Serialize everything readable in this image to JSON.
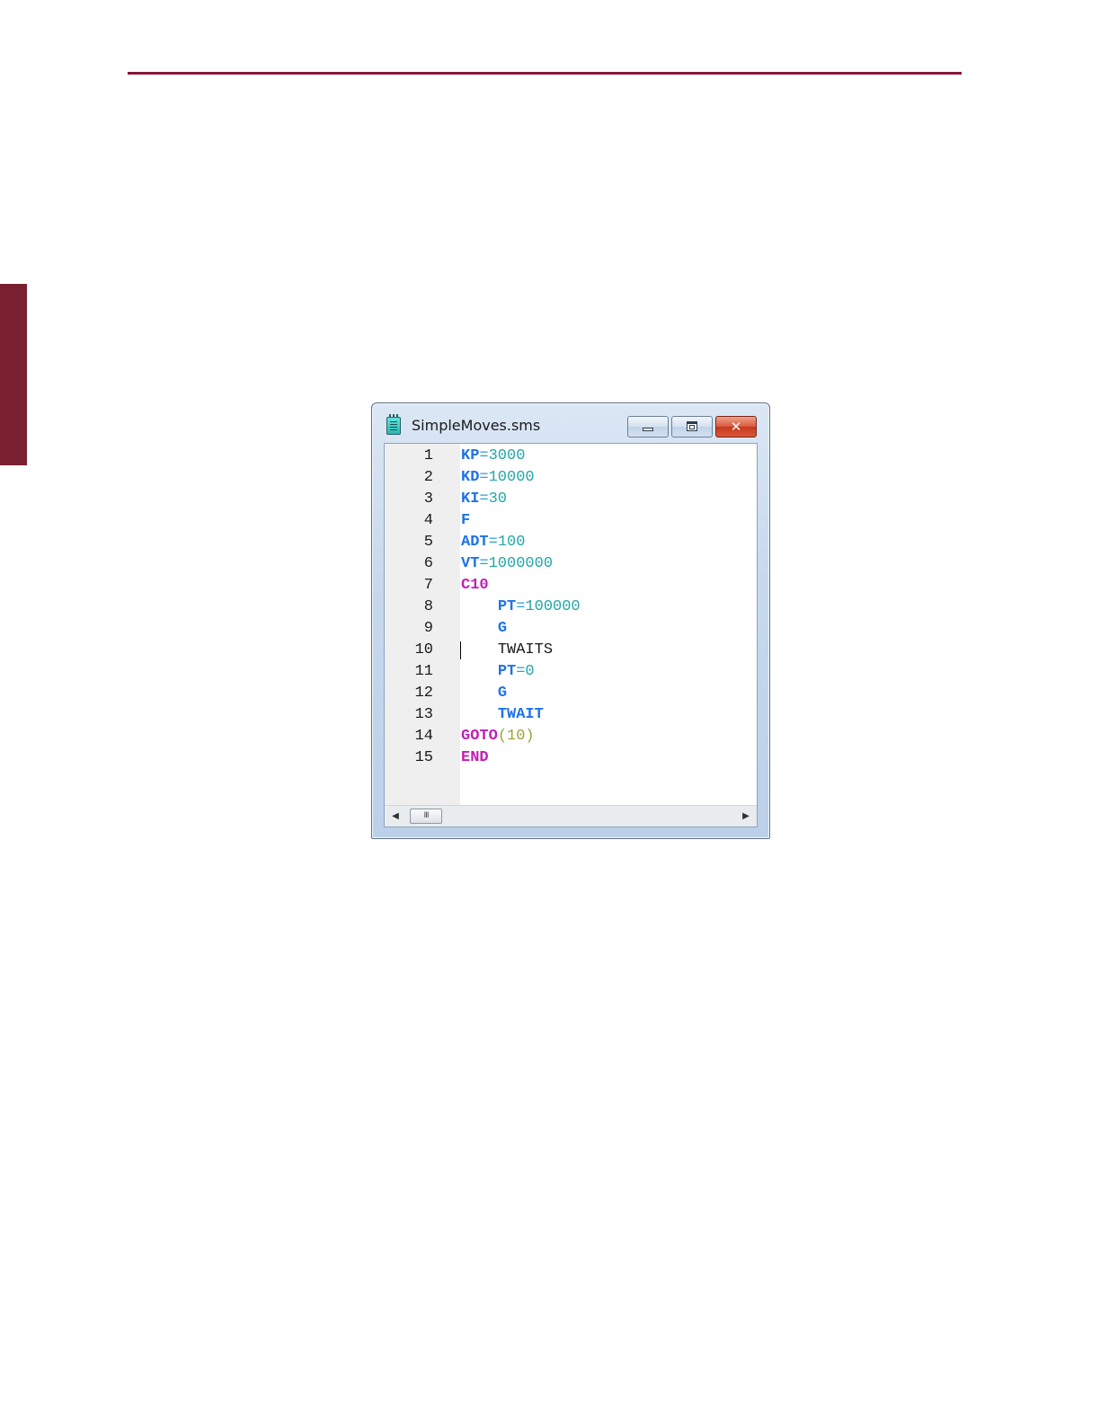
{
  "window": {
    "title": "SimpleMoves.sms",
    "icon": "document-icon",
    "buttons": {
      "minimize": "minimize-icon",
      "maximize": "maximize-icon",
      "close": "✕"
    }
  },
  "editor": {
    "line_numbers": [
      "1",
      "2",
      "3",
      "4",
      "5",
      "6",
      "7",
      "8",
      "9",
      "10",
      "11",
      "12",
      "13",
      "14",
      "15"
    ],
    "caret_line": 10,
    "lines": [
      [
        {
          "t": "KP",
          "c": "kw"
        },
        {
          "t": "=",
          "c": "op"
        },
        {
          "t": "3000",
          "c": "num"
        }
      ],
      [
        {
          "t": "KD",
          "c": "kw"
        },
        {
          "t": "=",
          "c": "op"
        },
        {
          "t": "10000",
          "c": "num"
        }
      ],
      [
        {
          "t": "KI",
          "c": "kw"
        },
        {
          "t": "=",
          "c": "op"
        },
        {
          "t": "30",
          "c": "num"
        }
      ],
      [
        {
          "t": "F",
          "c": "kw"
        }
      ],
      [
        {
          "t": "ADT",
          "c": "kw"
        },
        {
          "t": "=",
          "c": "op"
        },
        {
          "t": "100",
          "c": "num"
        }
      ],
      [
        {
          "t": "VT",
          "c": "kw"
        },
        {
          "t": "=",
          "c": "op"
        },
        {
          "t": "1000000",
          "c": "num"
        }
      ],
      [
        {
          "t": "C10",
          "c": "flow"
        }
      ],
      [
        {
          "t": "    ",
          "c": "plain"
        },
        {
          "t": "PT",
          "c": "kw"
        },
        {
          "t": "=",
          "c": "op"
        },
        {
          "t": "100000",
          "c": "num"
        }
      ],
      [
        {
          "t": "    ",
          "c": "plain"
        },
        {
          "t": "G",
          "c": "kw"
        }
      ],
      [
        {
          "t": "    ",
          "c": "plain"
        },
        {
          "t": "TWAITS",
          "c": "plain"
        }
      ],
      [
        {
          "t": "    ",
          "c": "plain"
        },
        {
          "t": "PT",
          "c": "kw"
        },
        {
          "t": "=",
          "c": "op"
        },
        {
          "t": "0",
          "c": "num"
        }
      ],
      [
        {
          "t": "    ",
          "c": "plain"
        },
        {
          "t": "G",
          "c": "kw"
        }
      ],
      [
        {
          "t": "    ",
          "c": "plain"
        },
        {
          "t": "TWAIT",
          "c": "kw"
        }
      ],
      [
        {
          "t": "GOTO",
          "c": "flow"
        },
        {
          "t": "(10)",
          "c": "paren"
        }
      ],
      [
        {
          "t": "END",
          "c": "flow"
        }
      ]
    ]
  },
  "scrollbar": {
    "left_arrow": "◀",
    "right_arrow": "▶",
    "thumb_grip": "III"
  },
  "colors": {
    "accent_rule": "#8b1538",
    "side_tab": "#7a1f30",
    "keyword": "#1e73e8",
    "number": "#24a6a6",
    "flow_keyword": "#c21eb5"
  }
}
